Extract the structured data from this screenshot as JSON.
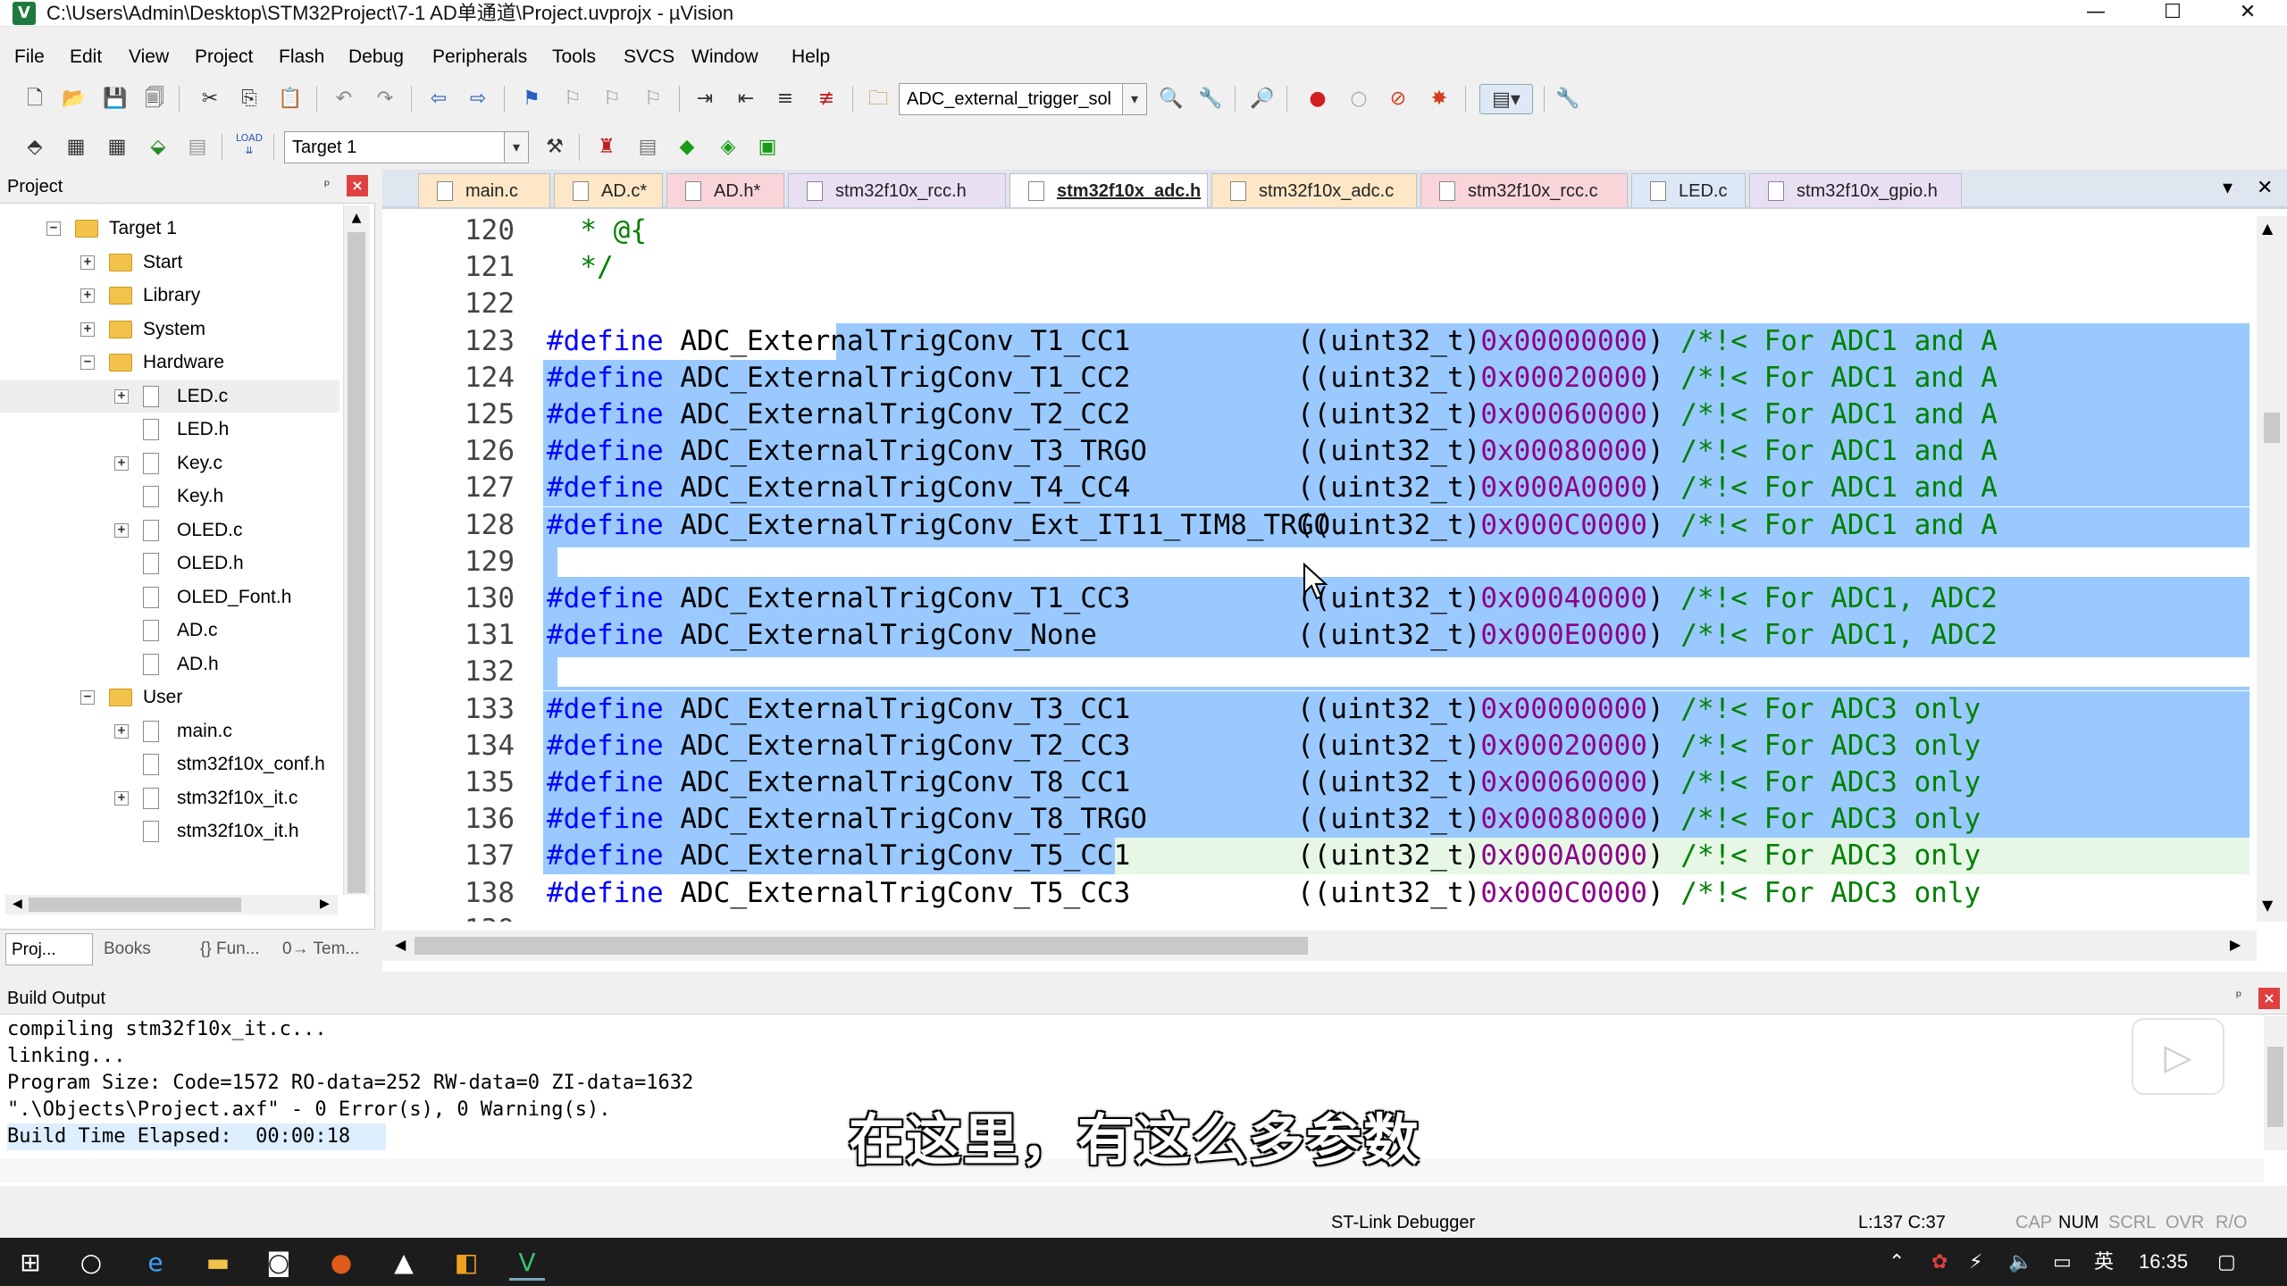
{
  "window": {
    "title": "C:\\Users\\Admin\\Desktop\\STM32Project\\7-1 AD单通道\\Project.uvprojx - µVision",
    "app_icon": "V",
    "minimize": "—",
    "maximize": "☐",
    "close": "✕"
  },
  "menu": [
    "File",
    "Edit",
    "View",
    "Project",
    "Flash",
    "Debug",
    "Peripherals",
    "Tools",
    "SVCS",
    "Window",
    "Help"
  ],
  "toolbar": {
    "find_combo": "ADC_external_trigger_sol",
    "target_combo": "Target 1",
    "load_label": "LOAD"
  },
  "project": {
    "title": "Project",
    "pin": "ᵖ",
    "close": "×",
    "tree": [
      {
        "label": "Target 1",
        "type": "root",
        "exp": "−"
      },
      {
        "label": "Start",
        "type": "folder",
        "exp": "+"
      },
      {
        "label": "Library",
        "type": "folder",
        "exp": "+"
      },
      {
        "label": "System",
        "type": "folder",
        "exp": "+"
      },
      {
        "label": "Hardware",
        "type": "folder",
        "exp": "−"
      },
      {
        "label": "LED.c",
        "type": "file",
        "exp": "+"
      },
      {
        "label": "LED.h",
        "type": "file",
        "exp": ""
      },
      {
        "label": "Key.c",
        "type": "file",
        "exp": "+"
      },
      {
        "label": "Key.h",
        "type": "file",
        "exp": ""
      },
      {
        "label": "OLED.c",
        "type": "file",
        "exp": "+"
      },
      {
        "label": "OLED.h",
        "type": "file",
        "exp": ""
      },
      {
        "label": "OLED_Font.h",
        "type": "file",
        "exp": ""
      },
      {
        "label": "AD.c",
        "type": "file",
        "exp": ""
      },
      {
        "label": "AD.h",
        "type": "file",
        "exp": ""
      },
      {
        "label": "User",
        "type": "folder",
        "exp": "−"
      },
      {
        "label": "main.c",
        "type": "file",
        "exp": "+"
      },
      {
        "label": "stm32f10x_conf.h",
        "type": "file",
        "exp": ""
      },
      {
        "label": "stm32f10x_it.c",
        "type": "file",
        "exp": "+"
      },
      {
        "label": "stm32f10x_it.h",
        "type": "file",
        "exp": ""
      }
    ],
    "tabs": [
      "Proj...",
      "Books",
      "{} Fun...",
      "0→ Tem..."
    ]
  },
  "editor": {
    "tabs": [
      {
        "label": "main.c",
        "color": "#fde7c6"
      },
      {
        "label": "AD.c*",
        "color": "#fde7c6"
      },
      {
        "label": "AD.h*",
        "color": "#f9d5da"
      },
      {
        "label": "stm32f10x_rcc.h",
        "color": "#e9dff3"
      },
      {
        "label": "stm32f10x_adc.h",
        "color": "#ffffff",
        "active": true
      },
      {
        "label": "stm32f10x_adc.c",
        "color": "#fde7c6"
      },
      {
        "label": "stm32f10x_rcc.c",
        "color": "#f9d5da"
      },
      {
        "label": "LED.c",
        "color": "#dde8f6"
      },
      {
        "label": "stm32f10x_gpio.h",
        "color": "#e9dff3"
      }
    ],
    "tab_menu": "▾",
    "tab_close": "✕",
    "lines": [
      {
        "n": "120",
        "html": "  * @{"
      },
      {
        "n": "121",
        "html": "  */"
      },
      {
        "n": "122",
        "html": ""
      },
      {
        "n": "123",
        "name": "ADC_ExternalTrigConv_T1_CC1",
        "val": "0x00000000",
        "cmt": "/*!< For ADC1 and A"
      },
      {
        "n": "124",
        "name": "ADC_ExternalTrigConv_T1_CC2",
        "val": "0x00020000",
        "cmt": "/*!< For ADC1 and A"
      },
      {
        "n": "125",
        "name": "ADC_ExternalTrigConv_T2_CC2",
        "val": "0x00060000",
        "cmt": "/*!< For ADC1 and A"
      },
      {
        "n": "126",
        "name": "ADC_ExternalTrigConv_T3_TRGO",
        "val": "0x00080000",
        "cmt": "/*!< For ADC1 and A"
      },
      {
        "n": "127",
        "name": "ADC_ExternalTrigConv_T4_CC4",
        "val": "0x000A0000",
        "cmt": "/*!< For ADC1 and A"
      },
      {
        "n": "128",
        "name": "ADC_ExternalTrigConv_Ext_IT11_TIM8_TRGO",
        "val": "0x000C0000",
        "cmt": "/*!< For ADC1 and A"
      },
      {
        "n": "129",
        "html": ""
      },
      {
        "n": "130",
        "name": "ADC_ExternalTrigConv_T1_CC3",
        "val": "0x00040000",
        "cmt": "/*!< For ADC1, ADC2"
      },
      {
        "n": "131",
        "name": "ADC_ExternalTrigConv_None",
        "val": "0x000E0000",
        "cmt": "/*!< For ADC1, ADC2"
      },
      {
        "n": "132",
        "html": ""
      },
      {
        "n": "133",
        "name": "ADC_ExternalTrigConv_T3_CC1",
        "val": "0x00000000",
        "cmt": "/*!< For ADC3 only"
      },
      {
        "n": "134",
        "name": "ADC_ExternalTrigConv_T2_CC3",
        "val": "0x00020000",
        "cmt": "/*!< For ADC3 only"
      },
      {
        "n": "135",
        "name": "ADC_ExternalTrigConv_T8_CC1",
        "val": "0x00060000",
        "cmt": "/*!< For ADC3 only"
      },
      {
        "n": "136",
        "name": "ADC_ExternalTrigConv_T8_TRGO",
        "val": "0x00080000",
        "cmt": "/*!< For ADC3 only"
      },
      {
        "n": "137",
        "name": "ADC_ExternalTrigConv_T5_CC1",
        "val": "0x000A0000",
        "cmt": "/*!< For ADC3 only"
      },
      {
        "n": "138",
        "name": "ADC_ExternalTrigConv_T5_CC3",
        "val": "0x000C0000",
        "cmt": "/*!< For ADC3 only"
      },
      {
        "n": "139",
        "html": ""
      }
    ],
    "define_kw": "#define",
    "cast": "((uint32_t)"
  },
  "build": {
    "title": "Build Output",
    "lines": [
      "compiling stm32f10x_it.c...",
      "linking...",
      "Program Size: Code=1572 RO-data=252 RW-data=0 ZI-data=1632",
      "\".\\Objects\\Project.axf\" - 0 Error(s), 0 Warning(s).",
      "Build Time Elapsed:  00:00:18"
    ]
  },
  "subtitle": "在这里，有这么多参数",
  "status": {
    "debugger": "ST-Link Debugger",
    "position": "L:137 C:37",
    "cap": "CAP",
    "num": "NUM",
    "scrl": "SCRL",
    "ovr": "OVR",
    "rw": "R/O"
  },
  "taskbar": {
    "time": "16:35",
    "ime": "英"
  },
  "colors": {
    "selection": "#99c9ff",
    "keyword": "#0000ff",
    "number": "#8b008b",
    "comment": "#008000"
  }
}
